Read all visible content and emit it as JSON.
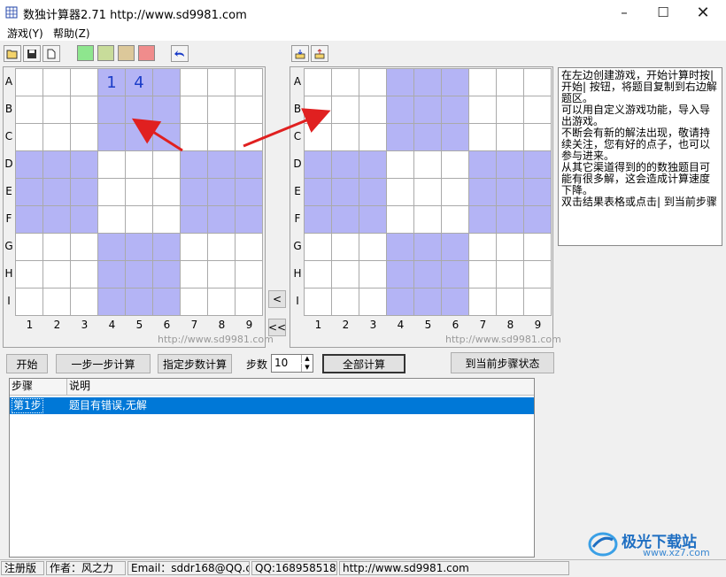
{
  "window": {
    "title": "数独计算器2.71 http://www.sd9981.com"
  },
  "menu": [
    "游戏(Y)",
    "帮助(Z)"
  ],
  "toolbar": {
    "icons": [
      "open-folder-icon",
      "save-disk-icon",
      "new-document-icon"
    ],
    "swatch_colors": [
      "#8ee68e",
      "#c8dc9a",
      "#dcc89a",
      "#f08c8c"
    ],
    "undo_icon": "undo-icon",
    "right_icons": [
      "import-icon",
      "export-icon"
    ]
  },
  "grid_left": {
    "row_labels": [
      "A",
      "B",
      "C",
      "D",
      "E",
      "F",
      "G",
      "H",
      "I"
    ],
    "col_labels": [
      "1",
      "2",
      "3",
      "4",
      "5",
      "6",
      "7",
      "8",
      "9"
    ],
    "givens": [
      {
        "row": 0,
        "col": 3,
        "value": "1"
      },
      {
        "row": 0,
        "col": 4,
        "value": "4"
      }
    ],
    "watermark": "http://www.sd9981.com"
  },
  "grid_right": {
    "row_labels": [
      "A",
      "B",
      "C",
      "D",
      "E",
      "F",
      "G",
      "H",
      "I"
    ],
    "col_labels": [
      "1",
      "2",
      "3",
      "4",
      "5",
      "6",
      "7",
      "8",
      "9"
    ],
    "watermark": "http://www.sd9981.com"
  },
  "shade_color": "#b4b4f5",
  "copy_buttons": [
    "<",
    "<<"
  ],
  "info_text": "在左边创建游戏，开始计算时按|\n开始| 按钮，将题目复制到右边解\n题区。\n可以用自定义游戏功能，导入导出游戏。\n不断会有新的解法出现，敬请持续关注，您有好的点子，也可以参与进来。\n从其它渠道得到的的数独题目可能有很多解，这会造成计算速度下降。\n双击结果表格或点击| 到当前步骤",
  "controls": {
    "start": "开始",
    "step": "一步一步计算",
    "step_count_btn": "指定步数计算",
    "steps_label": "步数",
    "steps_value": "10",
    "calc_all": "全部计算",
    "goto_state": "到当前步骤状态"
  },
  "list": {
    "headers": [
      "步骤",
      "说明"
    ],
    "rows": [
      {
        "step": "第1步",
        "desc": "题目有错误,无解"
      }
    ]
  },
  "status": [
    "注册版",
    "作者：风之力",
    "Email：sddr168@QQ.c",
    "QQ:168958518",
    "http://www.sd9981.com"
  ],
  "site_watermark": {
    "name": "极光下载站",
    "url": "www.xz7.com"
  }
}
